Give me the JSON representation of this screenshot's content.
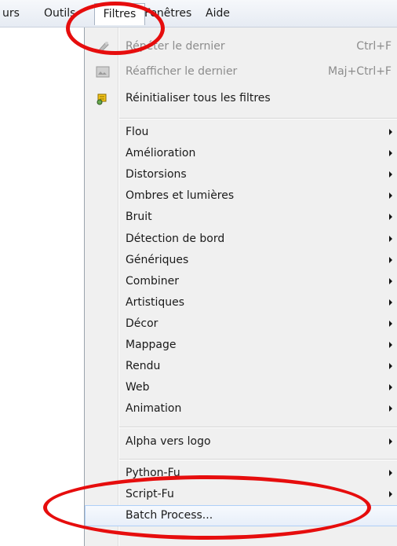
{
  "menubar": {
    "items": [
      {
        "label": "urs"
      },
      {
        "label": "Outils"
      },
      {
        "label": "Filtres"
      },
      {
        "label": "Fenêtres"
      },
      {
        "label": "Aide"
      }
    ]
  },
  "menu": {
    "top": [
      {
        "label": "Répéter le dernier",
        "shortcut": "Ctrl+F",
        "icon": "repeat-filter-icon",
        "disabled": true
      },
      {
        "label": "Réafficher le dernier",
        "shortcut": "Maj+Ctrl+F",
        "icon": "reshow-filter-icon",
        "disabled": true
      },
      {
        "label": "Réinitialiser tous les filtres",
        "icon": "reset-filters-icon",
        "disabled": false
      }
    ],
    "submenus": [
      {
        "label": "Flou"
      },
      {
        "label": "Amélioration"
      },
      {
        "label": "Distorsions"
      },
      {
        "label": "Ombres et lumières"
      },
      {
        "label": "Bruit"
      },
      {
        "label": "Détection de bord"
      },
      {
        "label": "Génériques"
      },
      {
        "label": "Combiner"
      },
      {
        "label": "Artistiques"
      },
      {
        "label": "Décor"
      },
      {
        "label": "Mappage"
      },
      {
        "label": "Rendu"
      },
      {
        "label": "Web"
      },
      {
        "label": "Animation"
      }
    ],
    "logo": {
      "label": "Alpha vers logo"
    },
    "scripts": [
      {
        "label": "Python-Fu"
      },
      {
        "label": "Script-Fu"
      }
    ],
    "batch": {
      "label": "Batch Process..."
    }
  },
  "colors": {
    "annotation": "#e60d0d",
    "highlight": "#aecff7"
  }
}
